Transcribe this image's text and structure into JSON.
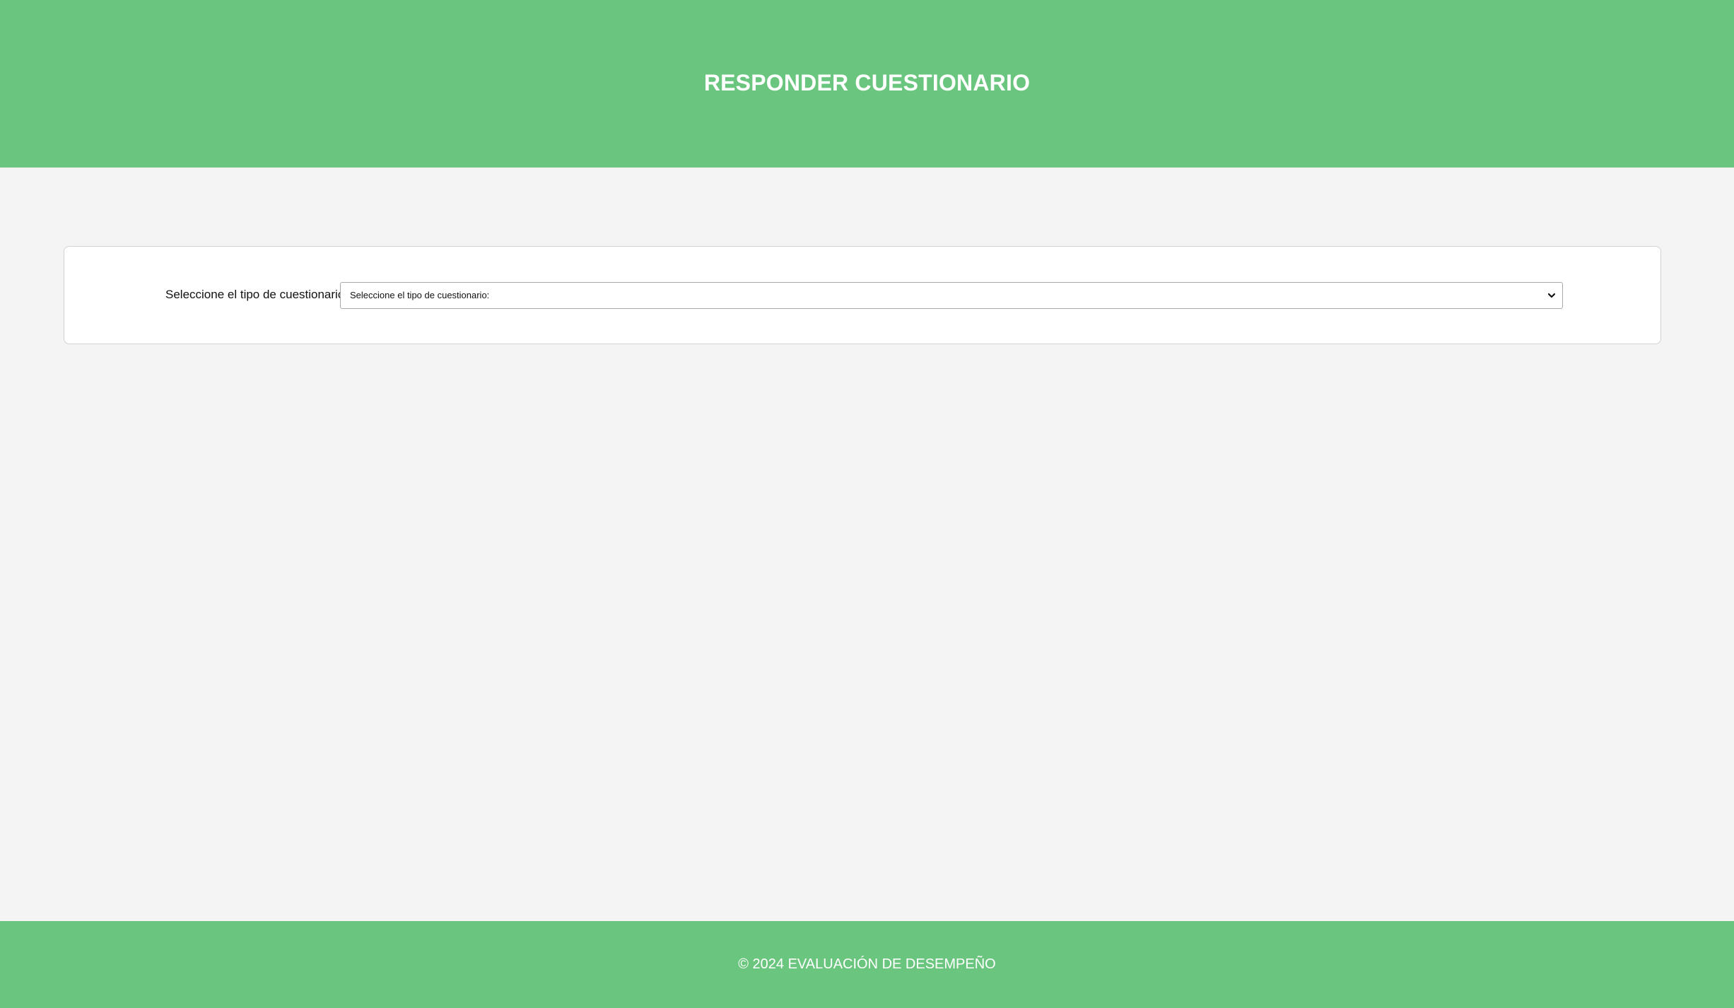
{
  "header": {
    "title": "RESPONDER CUESTIONARIO"
  },
  "form": {
    "label": "Seleccione el tipo de cuestionario:",
    "select": {
      "selected": "Seleccione el tipo de cuestionario:"
    }
  },
  "footer": {
    "text": "© 2024 EVALUACIÓN DE DESEMPEÑO"
  },
  "colors": {
    "primary_green": "#6ac67e",
    "background": "#f4f4f4",
    "card_background": "#ffffff"
  },
  "icons": {
    "select_arrow": "chevron-down-icon"
  }
}
